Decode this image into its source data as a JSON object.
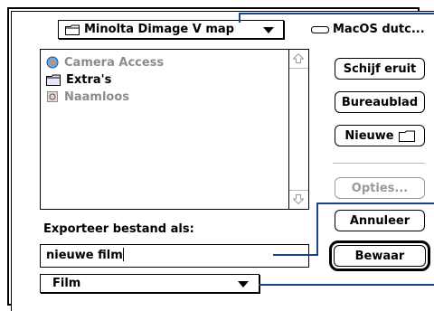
{
  "dialog": {
    "folder_popup": {
      "label": "Minolta Dimage V map",
      "icon": "folder-icon"
    },
    "disk": {
      "label": "MacOS dutc...",
      "icon": "disk-icon"
    },
    "files": [
      {
        "name": "Camera Access",
        "icon": "app-icon",
        "enabled": false
      },
      {
        "name": "Extra's",
        "icon": "folder-icon",
        "enabled": true
      },
      {
        "name": "Naamloos",
        "icon": "document-icon",
        "enabled": false
      }
    ],
    "buttons": {
      "eject": "Schijf eruit",
      "desktop": "Bureaublad",
      "new_folder": "Nieuwe",
      "options": "Opties...",
      "cancel": "Annuleer",
      "save": "Bewaar"
    },
    "export_label": "Exporteer bestand als:",
    "filename_value": "nieuwe film",
    "format_popup": "Film"
  },
  "colors": {
    "callout": "#1d3f8f",
    "disabled": "#9a9a9a"
  }
}
